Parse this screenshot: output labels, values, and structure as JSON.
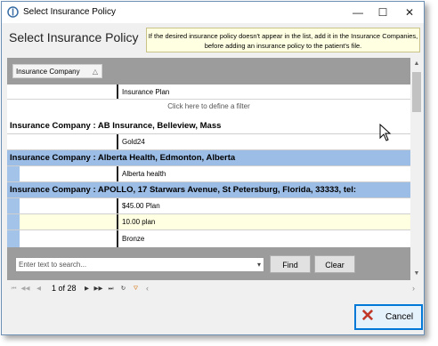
{
  "window": {
    "title": "Select Insurance Policy",
    "controls": {
      "minimize": "—",
      "maximize": "☐",
      "close": "✕"
    }
  },
  "header": {
    "title": "Select Insurance Policy",
    "note": "If the desired insurance policy doesn't appear in the list, add it in the Insurance Companies, before adding an insurance policy to the patient's file."
  },
  "grid": {
    "group_column": "Insurance Company",
    "column_header": "Insurance Plan",
    "filter_hint": "Click here to define a filter",
    "groups": [
      {
        "label": "Insurance Company : AB Insurance, Belleview, Mass",
        "plans": [
          "Gold24"
        ]
      },
      {
        "label": "Insurance Company : Alberta Health, Edmonton, Alberta",
        "plans": [
          "Alberta health"
        ]
      },
      {
        "label": "Insurance Company : APOLLO, 17 Starwars Avenue, St Petersburg, Florida, 33333, tel:",
        "plans": [
          "$45.00 Plan",
          "10.00 plan",
          "Bronze"
        ]
      }
    ]
  },
  "search": {
    "placeholder": "Enter text to search...",
    "find_label": "Find",
    "clear_label": "Clear"
  },
  "pager": {
    "page_info": "1 of 28"
  },
  "footer": {
    "cancel_label": "Cancel"
  },
  "colors": {
    "group_selected": "#9cbde6",
    "row_alt": "#ffffe1",
    "accent": "#0078d7"
  }
}
